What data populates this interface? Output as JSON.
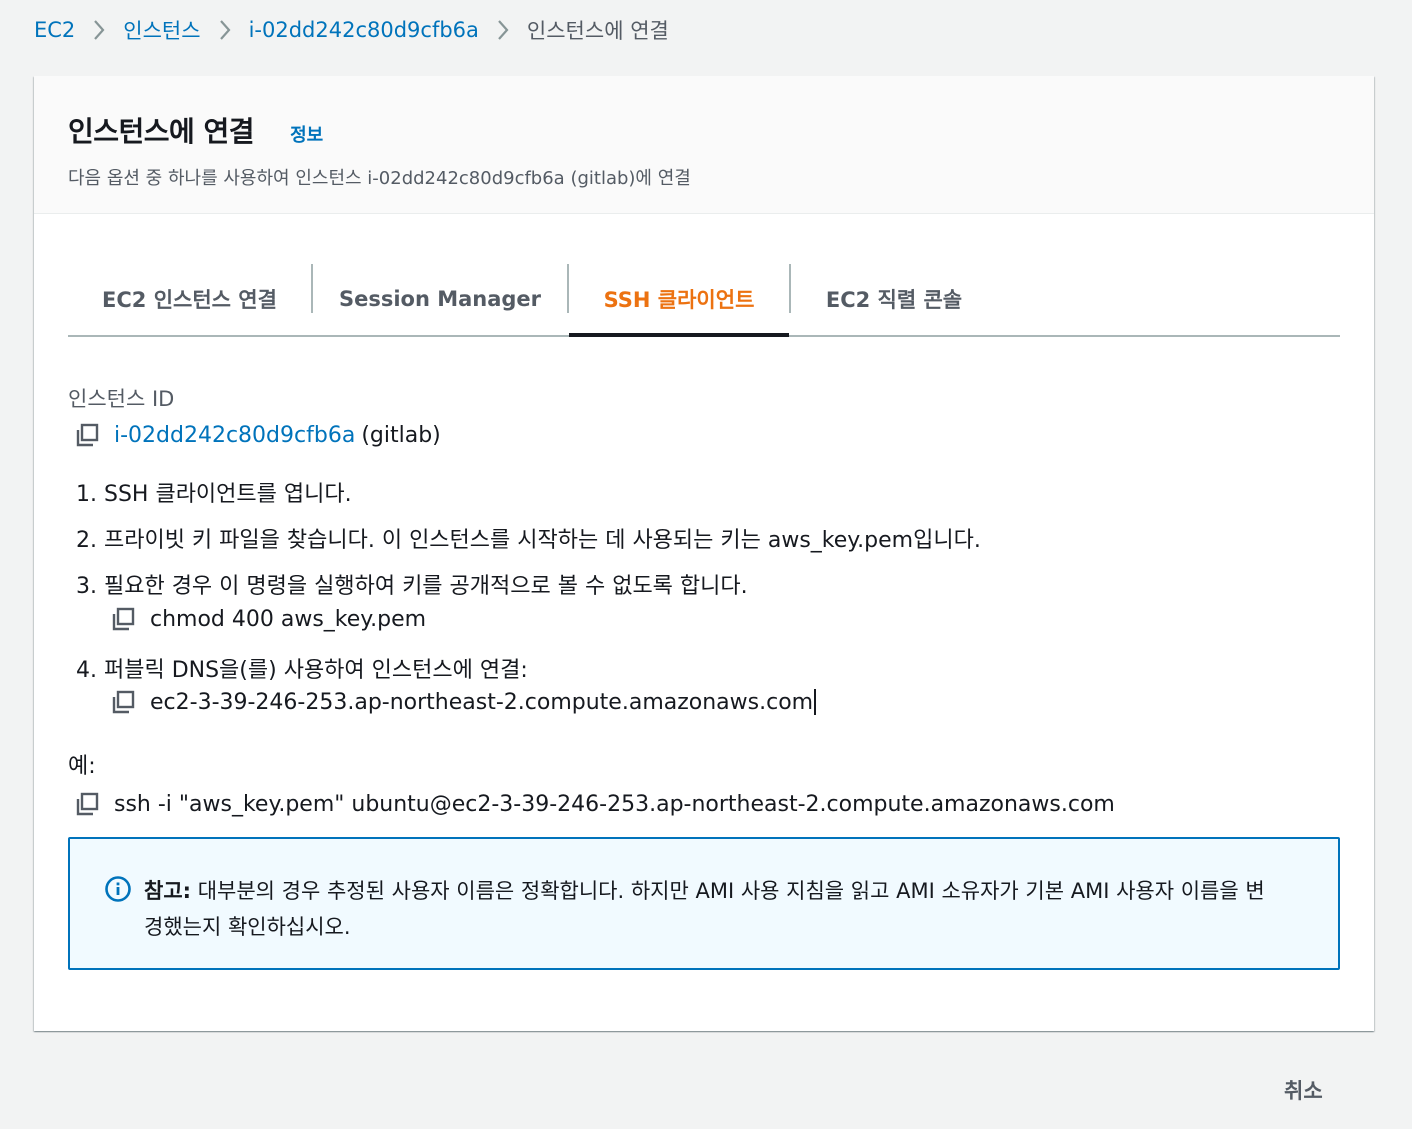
{
  "breadcrumb": {
    "items": [
      {
        "label": "EC2"
      },
      {
        "label": "인스턴스"
      },
      {
        "label": "i-02dd242c80d9cfb6a"
      },
      {
        "label": "인스턴스에 연결"
      }
    ]
  },
  "header": {
    "title": "인스턴스에 연결",
    "info_link": "정보",
    "description": "다음 옵션 중 하나를 사용하여 인스턴스 i-02dd242c80d9cfb6a (gitlab)에 연결"
  },
  "tabs": [
    {
      "label": "EC2 인스턴스 연결",
      "active": false
    },
    {
      "label": "Session Manager",
      "active": false
    },
    {
      "label": "SSH 클라이언트",
      "active": true
    },
    {
      "label": "EC2 직렬 콘솔",
      "active": false
    }
  ],
  "instance": {
    "label": "인스턴스 ID",
    "id": "i-02dd242c80d9cfb6a",
    "name": "(gitlab)"
  },
  "steps": [
    "1. SSH 클라이언트를 엽니다.",
    "2. 프라이빗 키 파일을 찾습니다. 이 인스턴스를 시작하는 데 사용되는 키는 aws_key.pem입니다.",
    "3. 필요한 경우 이 명령을 실행하여 키를 공개적으로 볼 수 없도록 합니다.",
    "4. 퍼블릭 DNS을(를) 사용하여 인스턴스에 연결:"
  ],
  "commands": {
    "chmod": "chmod 400 aws_key.pem",
    "dns": "ec2-3-39-246-253.ap-northeast-2.compute.amazonaws.com",
    "example_label": "예:",
    "ssh": "ssh -i \"aws_key.pem\" ubuntu@ec2-3-39-246-253.ap-northeast-2.compute.amazonaws.com"
  },
  "alert": {
    "prefix": "참고:",
    "text_line1": " 대부분의 경우 추정된 사용자 이름은 정확합니다. 하지만 AMI 사용 지침을 읽고 AMI 소유자가 기본 AMI 사용자 이름을 변",
    "text_line2": "경했는지 확인하십시오."
  },
  "footer": {
    "cancel_label": "취소"
  },
  "colors": {
    "link": "#0073bb",
    "active_tab": "#ec7211",
    "alert_border": "#0073bb",
    "alert_bg": "#f1faff"
  }
}
